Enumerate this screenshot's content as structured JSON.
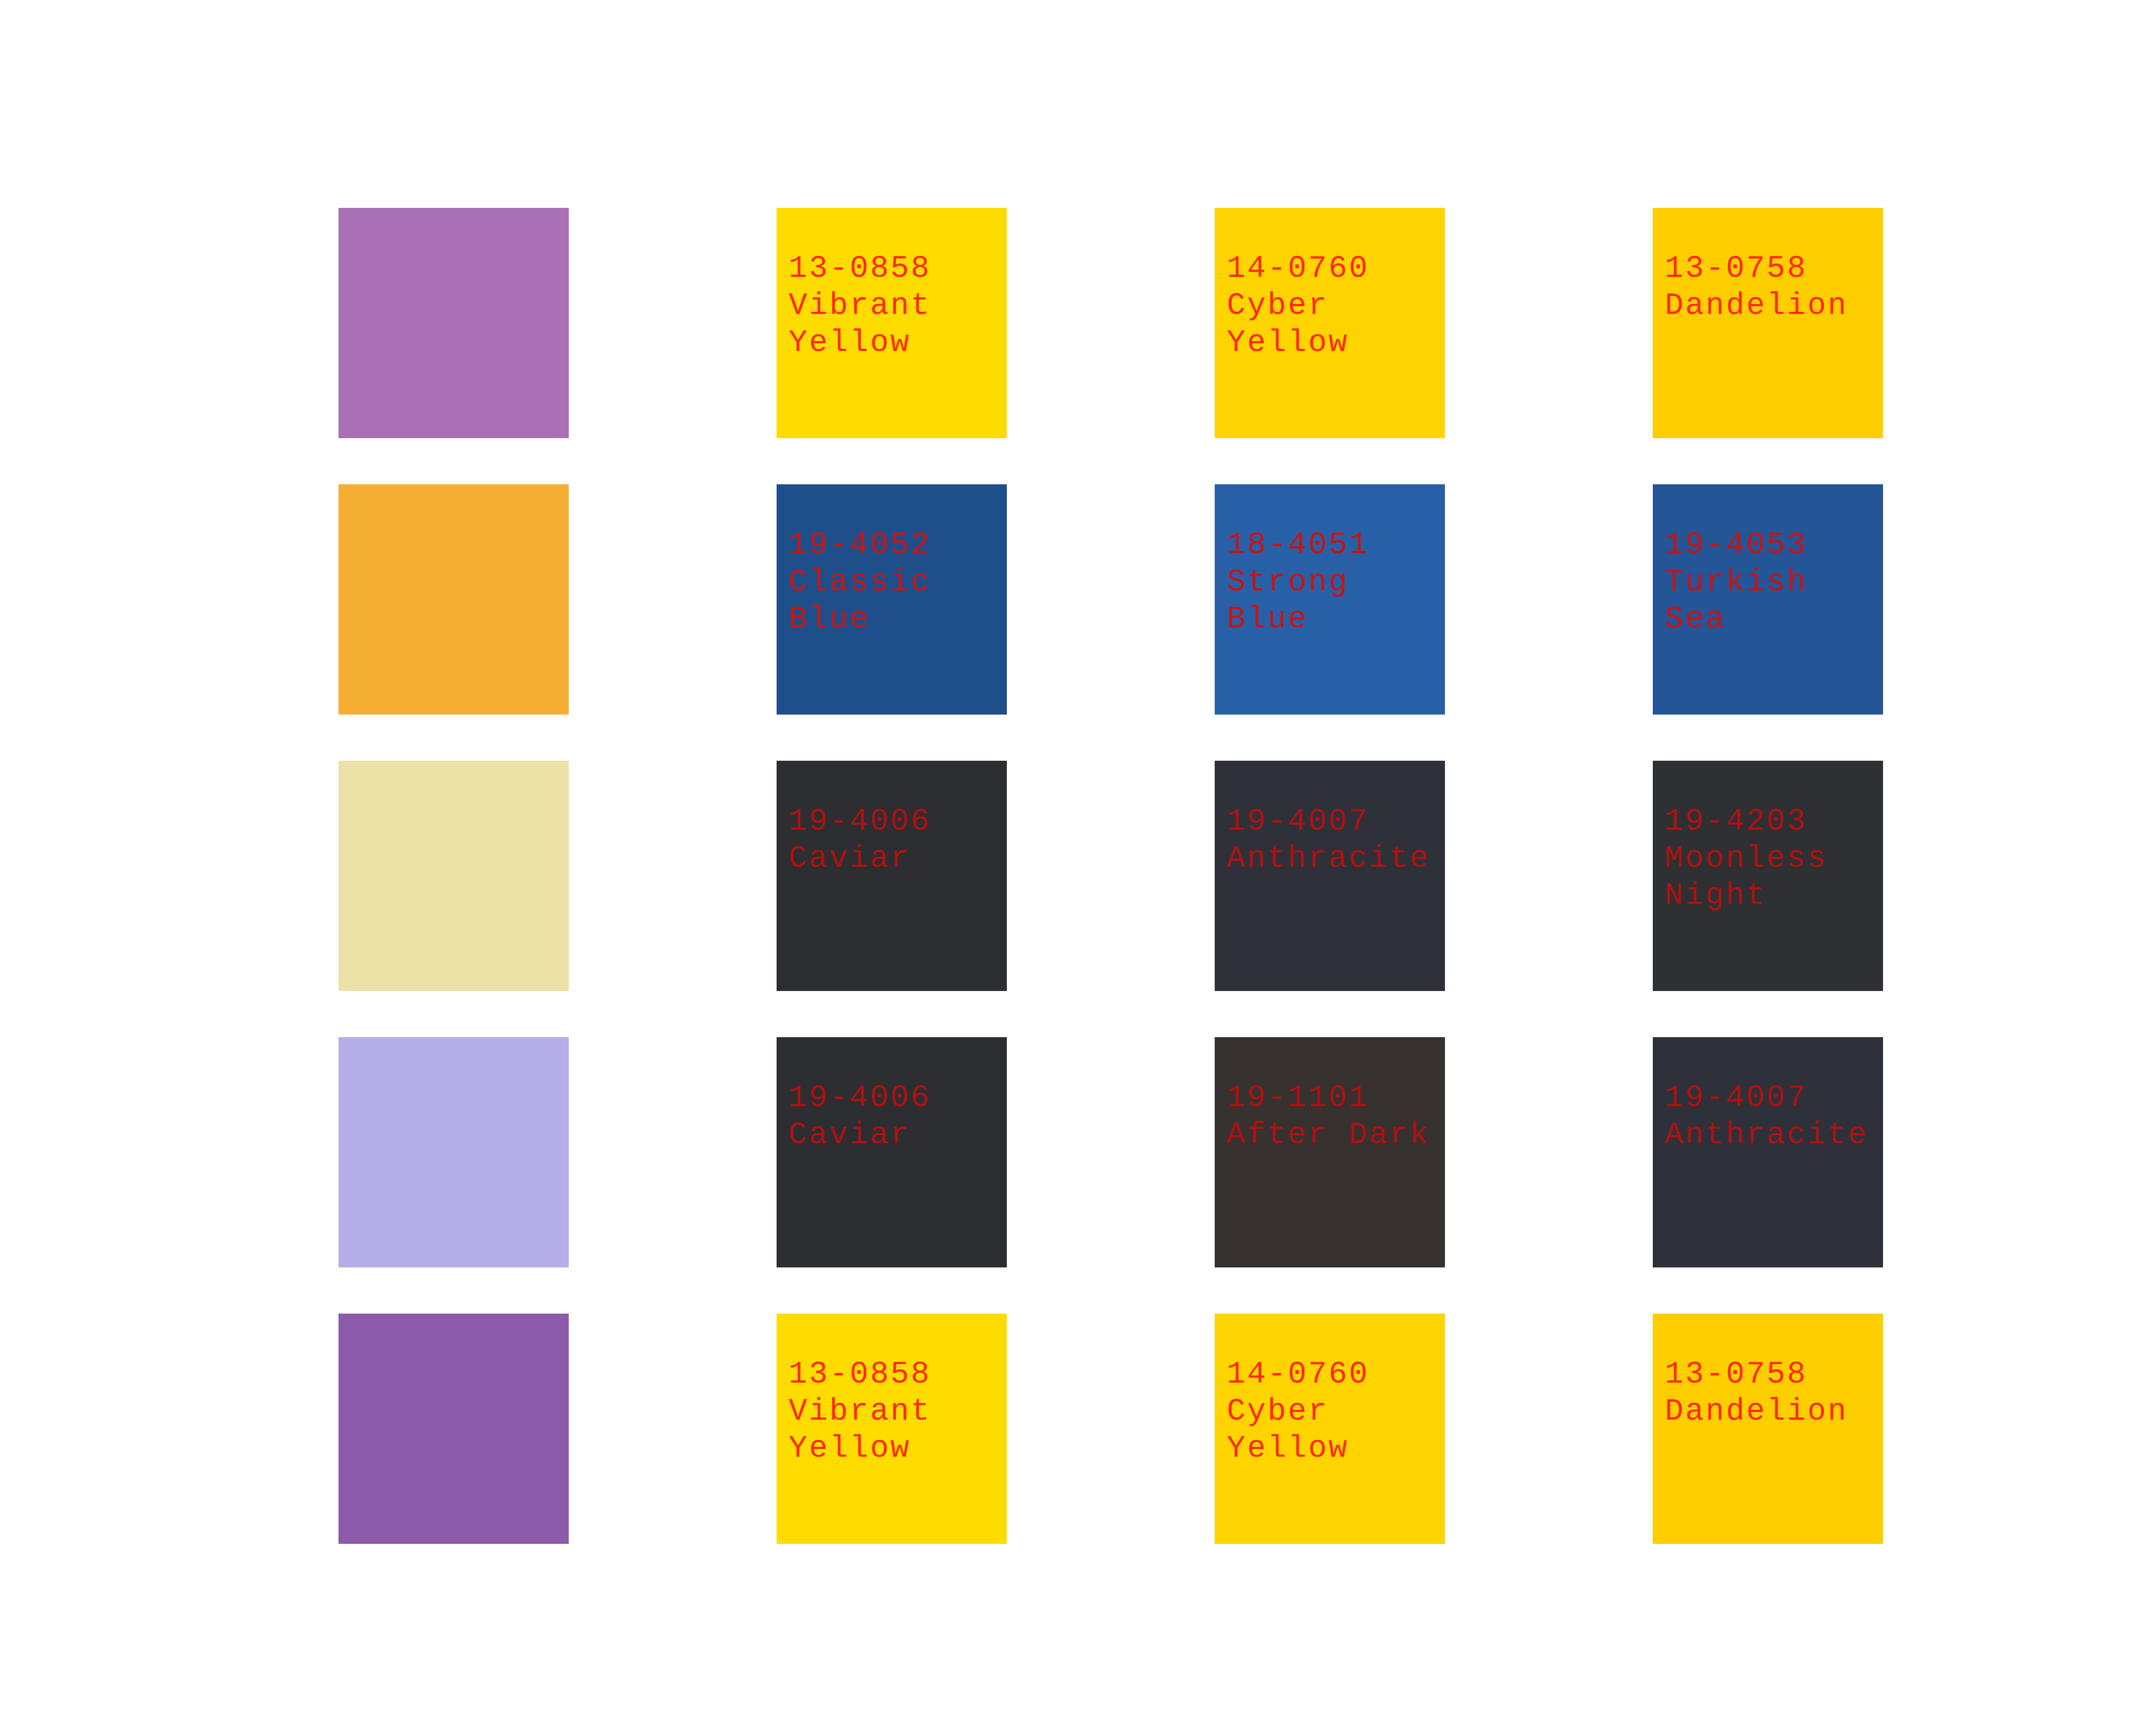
{
  "swatches": [
    {
      "color": "#A871B6",
      "code": "",
      "name": ""
    },
    {
      "color": "#FFDC00",
      "code": "13-0858",
      "name": "Vibrant Yellow",
      "text_color": "#FF2A00"
    },
    {
      "color": "#FFD400",
      "code": "14-0760",
      "name": "Cyber Yellow",
      "text_color": "#FF2A00"
    },
    {
      "color": "#FECE00",
      "code": "13-0758",
      "name": "Dandelion",
      "text_color": "#FF2A00"
    },
    {
      "color": "#F4AF33",
      "code": "",
      "name": ""
    },
    {
      "color": "#1F4F8A",
      "code": "19-4052",
      "name": "Classic Blue",
      "text_color": "#C81414"
    },
    {
      "color": "#2860A8",
      "code": "18-4051",
      "name": "Strong Blue",
      "text_color": "#C81414"
    },
    {
      "color": "#245596",
      "code": "19-4053",
      "name": "Turkish Sea",
      "text_color": "#C81414"
    },
    {
      "color": "#ECE2A8",
      "code": "",
      "name": ""
    },
    {
      "color": "#2C2E31",
      "code": "19-4006",
      "name": "Caviar",
      "text_color": "#B01010"
    },
    {
      "color": "#2E313A",
      "code": "19-4007",
      "name": "Anthracite",
      "text_color": "#B01010"
    },
    {
      "color": "#2E3033",
      "code": "19-4203",
      "name": "Moonless Night",
      "text_color": "#B01010"
    },
    {
      "color": "#B6AEE9",
      "code": "",
      "name": ""
    },
    {
      "color": "#2C2E31",
      "code": "19-4006",
      "name": "Caviar",
      "text_color": "#B01010"
    },
    {
      "color": "#373130",
      "code": "19-1101",
      "name": "After Dark",
      "text_color": "#B01010"
    },
    {
      "color": "#2E313A",
      "code": "19-4007",
      "name": "Anthracite",
      "text_color": "#B01010"
    },
    {
      "color": "#8C5BAA",
      "code": "",
      "name": ""
    },
    {
      "color": "#FFDC00",
      "code": "13-0858",
      "name": "Vibrant Yellow",
      "text_color": "#FF2A00"
    },
    {
      "color": "#FFD400",
      "code": "14-0760",
      "name": "Cyber Yellow",
      "text_color": "#FF2A00"
    },
    {
      "color": "#FECE00",
      "code": "13-0758",
      "name": "Dandelion",
      "text_color": "#FF2A00"
    }
  ]
}
